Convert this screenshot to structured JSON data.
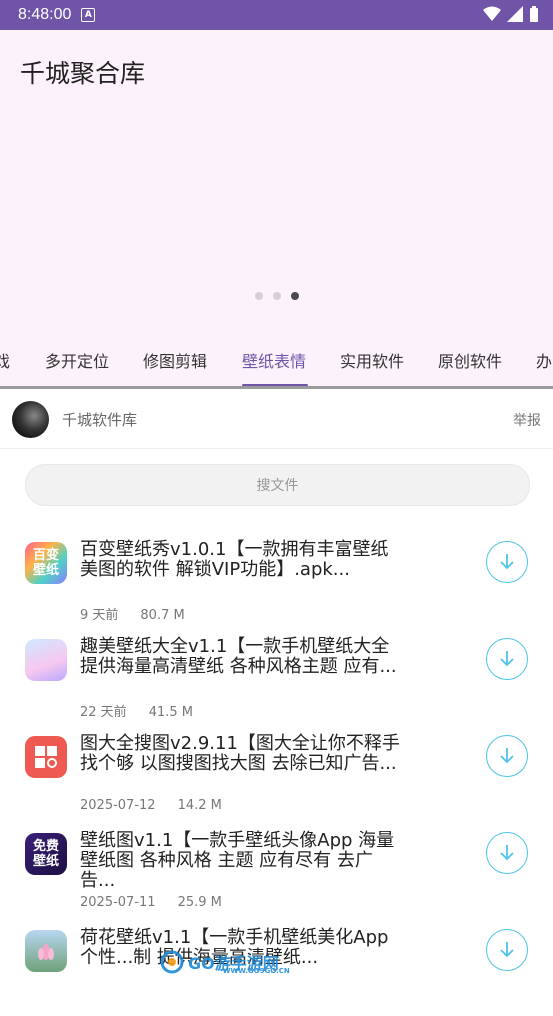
{
  "status": {
    "time": "8:48:00",
    "a_badge": "A"
  },
  "app": {
    "title": "千城聚合库"
  },
  "tabs": [
    {
      "label": "戏"
    },
    {
      "label": "多开定位"
    },
    {
      "label": "修图剪辑"
    },
    {
      "label": "壁纸表情",
      "active": true
    },
    {
      "label": "实用软件"
    },
    {
      "label": "原创软件"
    },
    {
      "label": "办"
    }
  ],
  "header": {
    "name": "千城软件库",
    "report": "举报"
  },
  "search": {
    "placeholder": "搜文件"
  },
  "items": [
    {
      "title": "百变壁纸秀v1.0.1【一款拥有丰富壁纸美图的软件 解锁VIP功能】.apk...",
      "age": "9 天前",
      "size": "80.7 M",
      "icon_text": "百变\n壁纸",
      "icon": "rainbow-gradient"
    },
    {
      "title": "趣美壁纸大全v1.1【一款手机壁纸大全 提供海量高清壁纸 各种风格主题 应有...",
      "age": "22 天前",
      "size": "41.5 M",
      "icon_text": "",
      "icon": "pastel-sky"
    },
    {
      "title": "图大全搜图v2.9.11【图大全让你不释手找个够 以图搜图找大图 去除已知广告...",
      "age": "2025-07-12",
      "size": "14.2 M",
      "icon_text": "",
      "icon": "red-grid-search"
    },
    {
      "title": "壁纸图v1.1【一款手壁纸头像App 海量壁纸图 各种风格 主题 应有尽有 去广告...",
      "age": "2025-07-11",
      "size": "25.9 M",
      "icon_text": "免费\n壁纸",
      "icon": "dark-purple"
    },
    {
      "title": "荷花壁纸v1.1【一款手机壁纸美化App 个性...制 提供海量高清壁纸...",
      "age": "",
      "size": "",
      "icon_text": "",
      "icon": "lotus"
    }
  ],
  "watermark": {
    "text": "GO游手游网",
    "url": "WWW.GO9GO.CN"
  },
  "colors": {
    "statusbar": "#6f54a7",
    "accent": "#6f54a7",
    "download": "#4fc3e8",
    "appbar_bg": "#fcf2fb"
  }
}
